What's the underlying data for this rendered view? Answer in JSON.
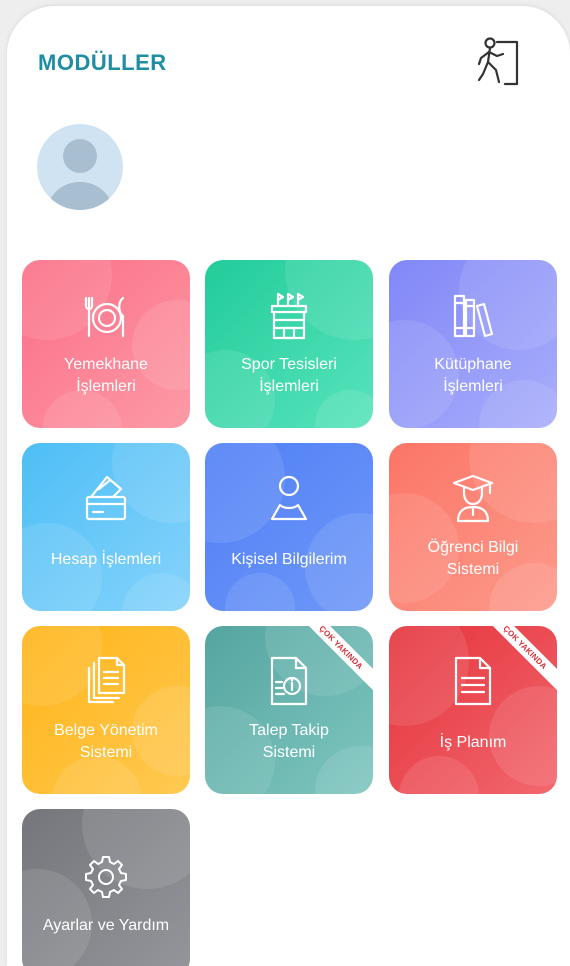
{
  "header": {
    "title": "MODÜLLER",
    "title_color": "#1f8ea3",
    "logout_icon": "logout-door-icon"
  },
  "profile": {
    "avatar_icon": "user-avatar-icon",
    "avatar_bg": "#cfe3f3",
    "avatar_fg": "#a8bfd1"
  },
  "tiles": [
    {
      "id": "yemekhane",
      "label": "Yemekhane\nİşlemleri",
      "icon": "plate-cutlery-icon",
      "colors": [
        "#fb6e86",
        "#fc9aa6"
      ]
    },
    {
      "id": "spor",
      "label": "Spor Tesisleri\nİşlemleri",
      "icon": "stadium-icon",
      "colors": [
        "#22cc9a",
        "#58e3bc"
      ]
    },
    {
      "id": "kutuphane",
      "label": "Kütüphane\nİşlemleri",
      "icon": "books-icon",
      "colors": [
        "#8187f7",
        "#a9aefb"
      ]
    },
    {
      "id": "hesap",
      "label": "Hesap İşlemleri",
      "icon": "card-wallet-icon",
      "colors": [
        "#4dbef6",
        "#86d3fb"
      ]
    },
    {
      "id": "kisisel",
      "label": "Kişisel Bilgilerim",
      "icon": "person-icon",
      "colors": [
        "#4f7ff5",
        "#6e98f8"
      ]
    },
    {
      "id": "ogrenci",
      "label": "Öğrenci Bilgi\nSistemi",
      "icon": "graduate-icon",
      "colors": [
        "#fb7566",
        "#fd9b8c"
      ]
    },
    {
      "id": "belge",
      "label": "Belge Yönetim\nSistemi",
      "icon": "documents-icon",
      "colors": [
        "#ffb417",
        "#ffc952"
      ]
    },
    {
      "id": "talep",
      "label": "Talep Takip\nSistemi",
      "icon": "info-document-icon",
      "colors": [
        "#55a5a0",
        "#7fc6c0"
      ],
      "badge": "ÇOK YAKINDA"
    },
    {
      "id": "isplanim",
      "label": "İş Planım",
      "icon": "list-document-icon",
      "colors": [
        "#e5323b",
        "#f2686e"
      ],
      "badge": "ÇOK YAKINDA"
    },
    {
      "id": "ayarlar",
      "label": "Ayarlar ve Yardım",
      "icon": "gear-icon",
      "colors": [
        "#74767b",
        "#94969b"
      ]
    }
  ],
  "badge_color": "#d2313a"
}
